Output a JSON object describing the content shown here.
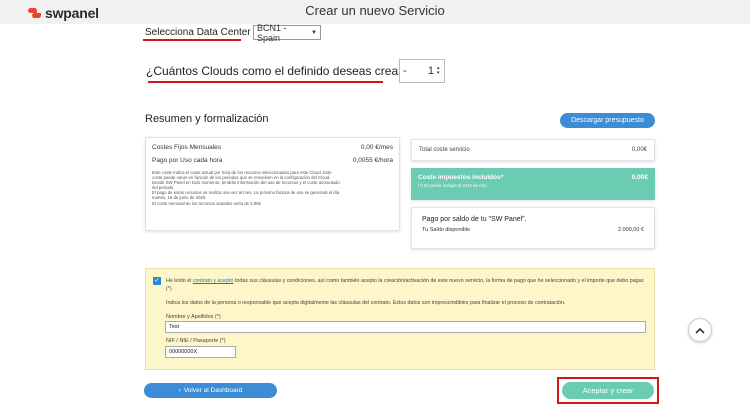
{
  "app": {
    "logo_text": "swpanel",
    "brand_color": "#e8482c"
  },
  "header": {
    "title": "Crear un nuevo Servicio"
  },
  "datacenter": {
    "label": "Selecciona Data Center",
    "selected": "BCN1 - Spain"
  },
  "clouds": {
    "question": "¿Cuántos Clouds como el definido deseas crear?",
    "minus": "-",
    "value": "1",
    "spinner": "▴▾"
  },
  "summary": {
    "title": "Resumen y formalización",
    "download_label": "Descargar presupuesto",
    "fixed_label": "Costes Fijos Mensuales",
    "fixed_value": "0,00 €/mes",
    "usage_label": "Pago por Uso cada hora",
    "usage_value": "0,0055 €/hora",
    "fine_print": [
      "Este coste indica el coste actual por hora de los recursos seleccionados para este Cloud. Este",
      "coste puede variar en función de los periodos que se resuelven en la configuración del Cloud.",
      "Desde SW Panel en todo momento, tendrás información del uso de recursos y el coste acumulado",
      "del periodo.",
      "El pago de estos recursos se realiza una vez al mes. La próxima factura de uso se generará el día",
      "martes, 16 de junio de 2020.",
      "El coste mensual de los recursos actuales sería de 3,96€"
    ],
    "total_label": "Total coste servicio",
    "total_value": "0,00€",
    "tax_label": "Coste impuestos incluidos*",
    "tax_value": "0,00€",
    "tax_note": "(*) El precio incluye el 21% de IVA.",
    "saldo_title": "Pago por saldo de tu \"SW Panel\".",
    "saldo_label": "Tu Saldo disponible",
    "saldo_value": "2.000,00 €"
  },
  "legal": {
    "prefix": "He leído el",
    "link": "contrato y acepto",
    "text": "todas sus cláusulas y condiciones, así como también acepto la creación/activación de este nuevo servicio, la forma de pago que he seleccionado y el importe que debo pagar.  (*)",
    "description": "Indica los datos de la persona o responsable que acepta digitalmente las cláusulas del contrato. Estos datos son imprescindibles para finalizar el proceso de contratación.",
    "name_label": "Nombre y Apellidos (*)",
    "name_value": "Test",
    "nif_label": "NIF / NIE / Pasaporte (*)",
    "nif_value": "00000000X"
  },
  "actions": {
    "back_label": "Volver al Dashboard",
    "accept_label": "Aceptar y crear"
  },
  "colors": {
    "accent_blue": "#3c8dd6",
    "accent_green": "#6acdb1",
    "highlight_red": "#d01818",
    "legal_bg": "#fdf6c8"
  }
}
